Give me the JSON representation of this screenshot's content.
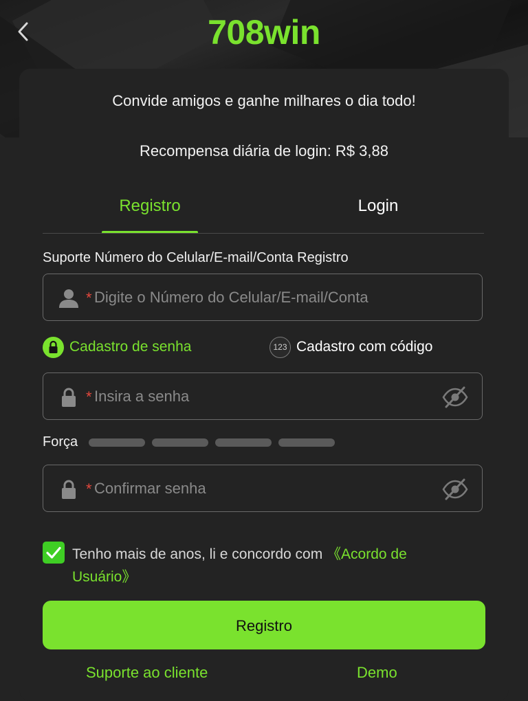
{
  "header": {
    "logo_text": "708win",
    "back_icon": "chevron-left-icon"
  },
  "promo": {
    "invite_text": "Convide amigos e ganhe milhares o dia todo!",
    "reward_text": "Recompensa diária de login: R$ 3,88"
  },
  "tabs": [
    {
      "label": "Registro",
      "active": true
    },
    {
      "label": "Login",
      "active": false
    }
  ],
  "form": {
    "account_label": "Suporte Número do Celular/E-mail/Conta Registro",
    "account_placeholder": "Digite o Número do Celular/E-mail/Conta",
    "required_mark": "*",
    "modes": [
      {
        "label": "Cadastro de senha",
        "icon": "lock-icon",
        "selected": true
      },
      {
        "label": "Cadastro com código",
        "icon_text": "123",
        "selected": false
      }
    ],
    "password_placeholder": "Insira a senha",
    "strength_label": "Força",
    "strength_level": 0,
    "confirm_placeholder": "Confirmar senha",
    "agree_checked": true,
    "agree_text": "Tenho mais de anos, li e concordo com ",
    "agree_link": "《Acordo de Usuário》",
    "submit_label": "Registro"
  },
  "footer": {
    "support_label": "Suporte ao cliente",
    "demo_label": "Demo"
  },
  "colors": {
    "accent": "#7ae22e",
    "background": "#232323",
    "required": "#e2473c"
  }
}
